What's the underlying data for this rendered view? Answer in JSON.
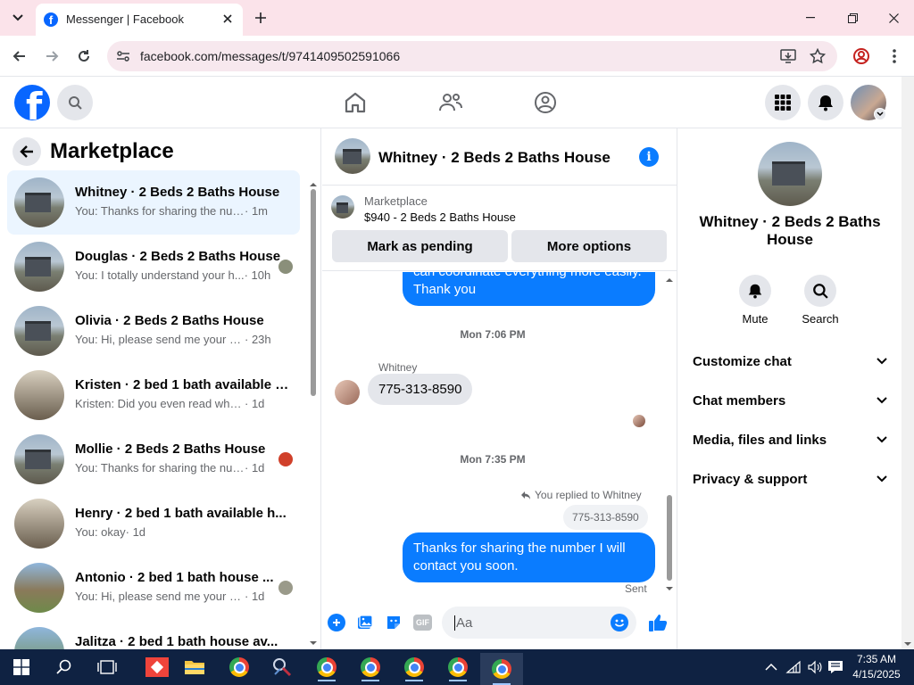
{
  "browser": {
    "tab_title": "Messenger | Facebook",
    "url": "facebook.com/messages/t/9741409502591066"
  },
  "left": {
    "title": "Marketplace",
    "conversations": [
      {
        "name": "Whitney · 2 Beds 2 Baths House",
        "preview": "You: Thanks for sharing the numbe...",
        "time": "· 1m",
        "active": true
      },
      {
        "name": "Douglas · 2 Beds 2 Baths House",
        "preview": "You: I totally understand your h...",
        "time": "· 10h"
      },
      {
        "name": "Olivia · 2 Beds 2 Baths House",
        "preview": "You: Hi, please send me your num...",
        "time": "· 23h"
      },
      {
        "name": "Kristen · 2 bed 1 bath available h...",
        "preview": "Kristen: Did you even read what I s...",
        "time": "· 1d"
      },
      {
        "name": "Mollie · 2 Beds 2 Baths House",
        "preview": "You: Thanks for sharing the num...",
        "time": "· 1d"
      },
      {
        "name": "Henry · 2 bed 1 bath available h...",
        "preview": "You: okay",
        "time": "· 1d"
      },
      {
        "name": "Antonio · 2 bed 1 bath house ...",
        "preview": "You: Hi, please send me your num...",
        "time": "· 1d"
      },
      {
        "name": "Jalitza · 2 bed 1 bath house av...",
        "preview": "",
        "time": ""
      }
    ]
  },
  "chat": {
    "title": "Whitney · 2 Beds 2 Baths House",
    "listing_label": "Marketplace",
    "listing_detail": "$940 - 2 Beds 2 Baths House",
    "mark_pending": "Mark as pending",
    "more_options": "More options",
    "msg_top": "can coordinate everything more easily. Thank you",
    "sep1": "Mon 7:06 PM",
    "sender_name": "Whitney",
    "incoming_msg": "775-313-8590",
    "sep2": "Mon 7:35 PM",
    "replied_to": "You replied to Whitney",
    "quoted_msg": "775-313-8590",
    "outgoing_msg": "Thanks for sharing the number I will contact you soon.",
    "sent_status": "Sent",
    "composer_placeholder": "Aa"
  },
  "right": {
    "title": "Whitney · 2 Beds 2 Baths House",
    "mute_label": "Mute",
    "search_label": "Search",
    "sections": [
      "Customize chat",
      "Chat members",
      "Media, files and links",
      "Privacy & support"
    ]
  },
  "taskbar": {
    "time": "7:35 AM",
    "date": "4/15/2025"
  },
  "colors": {
    "fb_blue": "#0866ff",
    "messenger_blue": "#0a7cff",
    "taskbar": "#0f2242"
  }
}
